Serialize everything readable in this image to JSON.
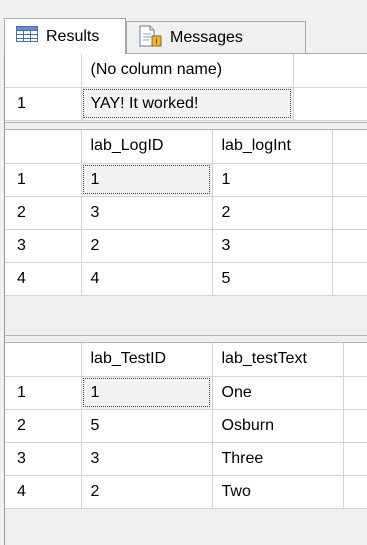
{
  "tabs": [
    {
      "label": "Results",
      "icon": "grid-icon",
      "active": true
    },
    {
      "label": "Messages",
      "icon": "messages-icon",
      "active": false
    }
  ],
  "result1": {
    "headers": [
      "(No column name)"
    ],
    "rows": [
      {
        "num": "1",
        "cells": [
          "YAY! It worked!"
        ]
      }
    ]
  },
  "result2": {
    "headers": [
      "lab_LogID",
      "lab_logInt"
    ],
    "rows": [
      {
        "num": "1",
        "cells": [
          "1",
          "1"
        ]
      },
      {
        "num": "2",
        "cells": [
          "3",
          "2"
        ]
      },
      {
        "num": "3",
        "cells": [
          "2",
          "3"
        ]
      },
      {
        "num": "4",
        "cells": [
          "4",
          "5"
        ]
      }
    ]
  },
  "result3": {
    "headers": [
      "lab_TestID",
      "lab_testText"
    ],
    "rows": [
      {
        "num": "1",
        "cells": [
          "1",
          "One"
        ]
      },
      {
        "num": "2",
        "cells": [
          "5",
          "Osburn"
        ]
      },
      {
        "num": "3",
        "cells": [
          "3",
          "Three"
        ]
      },
      {
        "num": "4",
        "cells": [
          "2",
          "Two"
        ]
      }
    ]
  }
}
